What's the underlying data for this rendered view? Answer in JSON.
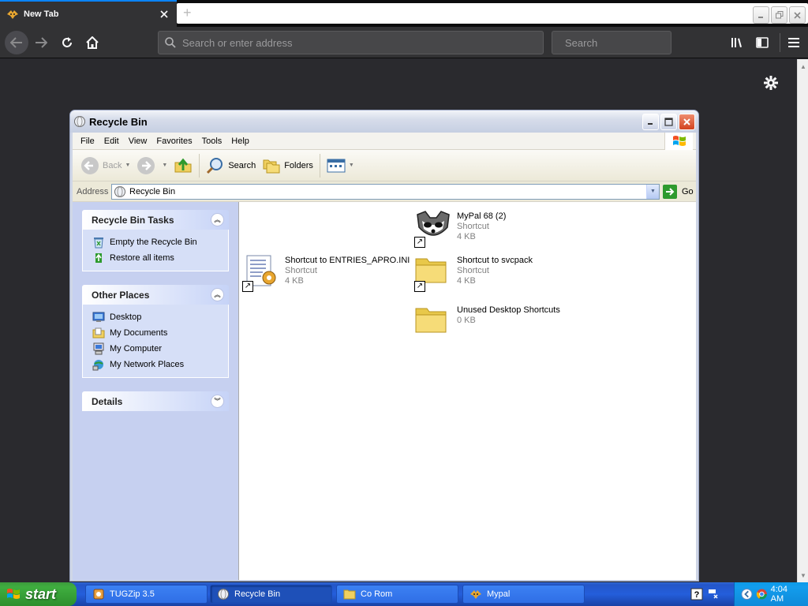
{
  "browser": {
    "tab": {
      "title": "New Tab",
      "close_icon": "close-icon",
      "favicon": "mypal-favicon"
    },
    "newtab_icon": "plus-icon",
    "nav": {
      "back_icon": "arrow-left-icon",
      "forward_icon": "arrow-right-icon",
      "reload_icon": "reload-icon",
      "home_icon": "home-icon"
    },
    "urlbar": {
      "placeholder": "Search or enter address",
      "value": ""
    },
    "searchbar": {
      "placeholder": "Search",
      "value": ""
    },
    "toolbar_icons": [
      "library-icon",
      "sidebar-icon",
      "hamburger-menu-icon"
    ],
    "content_gear_icon": "gear-icon"
  },
  "explorer": {
    "title": "Recycle Bin",
    "menu": [
      "File",
      "Edit",
      "View",
      "Favorites",
      "Tools",
      "Help"
    ],
    "toolbar": {
      "back": "Back",
      "search": "Search",
      "folders": "Folders"
    },
    "address": {
      "label": "Address",
      "value": "Recycle Bin",
      "go": "Go"
    },
    "taskpane": {
      "tasks": {
        "title": "Recycle Bin Tasks",
        "items": [
          "Empty the Recycle Bin",
          "Restore all items"
        ]
      },
      "places": {
        "title": "Other Places",
        "items": [
          "Desktop",
          "My Documents",
          "My Computer",
          "My Network Places"
        ]
      },
      "details": {
        "title": "Details"
      }
    },
    "files": [
      {
        "name": "MyPal 68 (2)",
        "type": "Shortcut",
        "size": "4 KB",
        "icon": "raccoon-icon",
        "shortcut": true
      },
      {
        "name": "Shortcut to ENTRIES_APRO.INI",
        "type": "Shortcut",
        "size": "4 KB",
        "icon": "ini-file-icon",
        "shortcut": true
      },
      {
        "name": "Shortcut to svcpack",
        "type": "Shortcut",
        "size": "4 KB",
        "icon": "folder-icon",
        "shortcut": true
      },
      {
        "name": "Unused Desktop Shortcuts",
        "type": "",
        "size": "0 KB",
        "icon": "folder-icon",
        "shortcut": false
      }
    ]
  },
  "taskbar": {
    "start": "start",
    "tasks": [
      {
        "label": "TUGZip 3.5",
        "icon": "tugzip-icon"
      },
      {
        "label": "Recycle Bin",
        "icon": "recycle-bin-icon",
        "active": true
      },
      {
        "label": "Co Rom",
        "icon": "folder-icon"
      },
      {
        "label": "Mypal",
        "icon": "mypal-icon"
      }
    ],
    "clock": "4:04 AM"
  },
  "colors": {
    "browser_dark": "#2a2a2e",
    "browser_accent": "#0a84ff",
    "xp_taskbar": "#245edb",
    "xp_start_green": "#3fae3f",
    "xp_taskpane": "#c6d0f0"
  }
}
